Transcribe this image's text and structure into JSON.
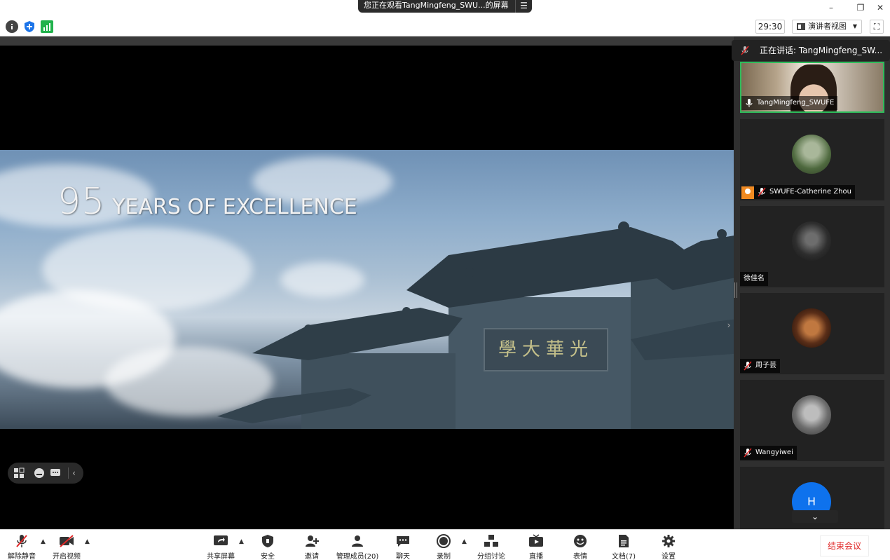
{
  "window": {
    "title": "您正在观看TangMingfeng_SWU...的屏幕",
    "menu_icon": "hamburger-icon",
    "minimize": "–",
    "restore": "❐",
    "close": "✕"
  },
  "infobar": {
    "timer": "29:30",
    "view_label": "演讲者视图",
    "fullscreen_icon": "⛶"
  },
  "slide": {
    "number": "95",
    "text": "YEARS OF EXCELLENCE",
    "plaque": "學大華光"
  },
  "float_controls": {
    "icons": [
      "layout-icon",
      "emoji-icon",
      "chat-icon",
      "collapse-icon"
    ]
  },
  "speaking": {
    "label": "正在讲话: TangMingfeng_SW..."
  },
  "participants": [
    {
      "name": "TangMingfeng_SWUFE",
      "mic": "on",
      "video": true
    },
    {
      "name": "SWUFE-Catherine Zhou",
      "mic": "muted",
      "host": true
    },
    {
      "name": "徐佳名",
      "mic": "none"
    },
    {
      "name": "周子芸",
      "mic": "muted"
    },
    {
      "name": "Wangyiwei",
      "mic": "muted"
    },
    {
      "name": "",
      "initial": "H"
    }
  ],
  "toolbar": {
    "unmute": "解除静音",
    "start_video": "开启视频",
    "share_screen": "共享屏幕",
    "security": "安全",
    "invite": "邀请",
    "participants": "管理成员(20)",
    "chat": "聊天",
    "record": "录制",
    "breakout": "分组讨论",
    "live": "直播",
    "reactions": "表情",
    "files": "文档(7)",
    "settings": "设置",
    "end": "结束会议"
  },
  "colors": {
    "accent_green": "#2ebd5b",
    "end_red": "#e02828",
    "avatar_blue": "#0e72ed",
    "host_orange": "#f08a22"
  }
}
